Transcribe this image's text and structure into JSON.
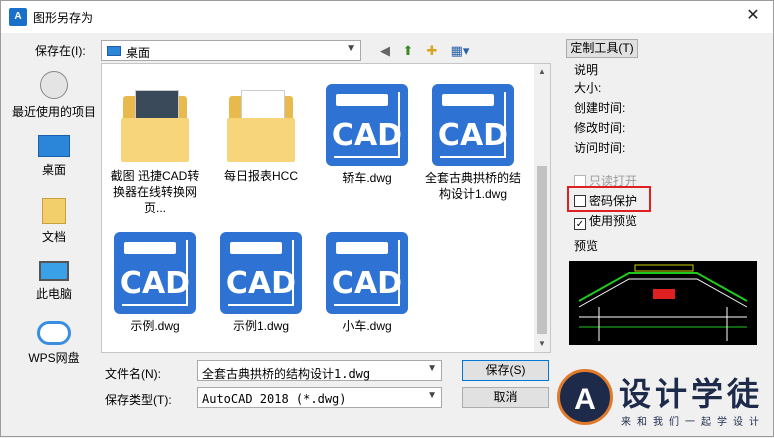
{
  "window": {
    "title": "图形另存为",
    "app_icon_text": "A"
  },
  "save_in": {
    "label": "保存在(I):",
    "value": "桌面"
  },
  "toolbar": {
    "tools_button": "定制工具(T)"
  },
  "places": [
    {
      "label": "最近使用的项目",
      "icon": "recent-items-icon"
    },
    {
      "label": "桌面",
      "icon": "desktop-icon"
    },
    {
      "label": "文档",
      "icon": "documents-icon"
    },
    {
      "label": "此电脑",
      "icon": "this-pc-icon"
    },
    {
      "label": "WPS网盘",
      "icon": "cloud-drive-icon"
    }
  ],
  "files": [
    {
      "name": "截图 迅捷CAD转换器在线转换网页...",
      "type": "folder"
    },
    {
      "name": "每日报表HCC",
      "type": "folder"
    },
    {
      "name": "轿车.dwg",
      "type": "cad"
    },
    {
      "name": "全套古典拱桥的结构设计1.dwg",
      "type": "cad"
    },
    {
      "name": "示例.dwg",
      "type": "cad"
    },
    {
      "name": "示例1.dwg",
      "type": "cad"
    },
    {
      "name": "小车.dwg",
      "type": "cad"
    }
  ],
  "cad_tile_text": "CAD",
  "filename": {
    "label": "文件名(N):",
    "value": "全套古典拱桥的结构设计1.dwg"
  },
  "filetype": {
    "label": "保存类型(T):",
    "value": "AutoCAD 2018 (*.dwg)"
  },
  "buttons": {
    "save": "保存(S)",
    "cancel": "取消"
  },
  "info": {
    "heading": "说明",
    "size": "大小:",
    "created": "创建时间:",
    "modified": "修改时间:",
    "accessed": "访问时间:"
  },
  "options": {
    "readonly": "只读打开",
    "password": "密码保护",
    "use_preview": "使用预览",
    "use_preview_checked": true
  },
  "preview_label": "预览",
  "logo": {
    "badge_letter": "A",
    "brand": "设计学徒",
    "slogan": "来和我们一起学设计"
  },
  "colors": {
    "cad_tile": "#2e73d3",
    "highlight_border": "#e02020",
    "accent": "#0078d7"
  }
}
